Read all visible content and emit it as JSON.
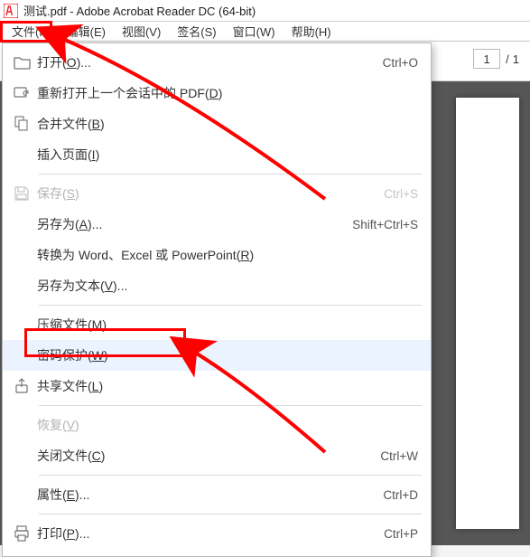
{
  "title": "测试.pdf - Adobe Acrobat Reader DC (64-bit)",
  "menubar": {
    "file": "文件(F)",
    "edit": "编辑(E)",
    "view": "视图(V)",
    "sign": "签名(S)",
    "window": "窗口(W)",
    "help": "帮助(H)"
  },
  "page": {
    "current": "1",
    "total": "1",
    "sep": "/"
  },
  "dropdown": {
    "open": {
      "label": "打开(O)...",
      "shortcut": "Ctrl+O"
    },
    "reopen": {
      "label": "重新打开上一个会话中的 PDF(D)"
    },
    "combine": {
      "label": "合并文件(B)"
    },
    "insert": {
      "label": "插入页面(I)"
    },
    "save": {
      "label": "保存(S)",
      "shortcut": "Ctrl+S"
    },
    "saveas": {
      "label": "另存为(A)...",
      "shortcut": "Shift+Ctrl+S"
    },
    "convert": {
      "label": "转换为 Word、Excel 或 PowerPoint(R)"
    },
    "savetext": {
      "label": "另存为文本(V)..."
    },
    "compress": {
      "label": "压缩文件(M)"
    },
    "password": {
      "label": "密码保护(W)"
    },
    "share": {
      "label": "共享文件(L)"
    },
    "revert": {
      "label": "恢复(V)"
    },
    "close": {
      "label": "关闭文件(C)",
      "shortcut": "Ctrl+W"
    },
    "properties": {
      "label": "属性(E)...",
      "shortcut": "Ctrl+D"
    },
    "print": {
      "label": "打印(P)...",
      "shortcut": "Ctrl+P"
    }
  }
}
